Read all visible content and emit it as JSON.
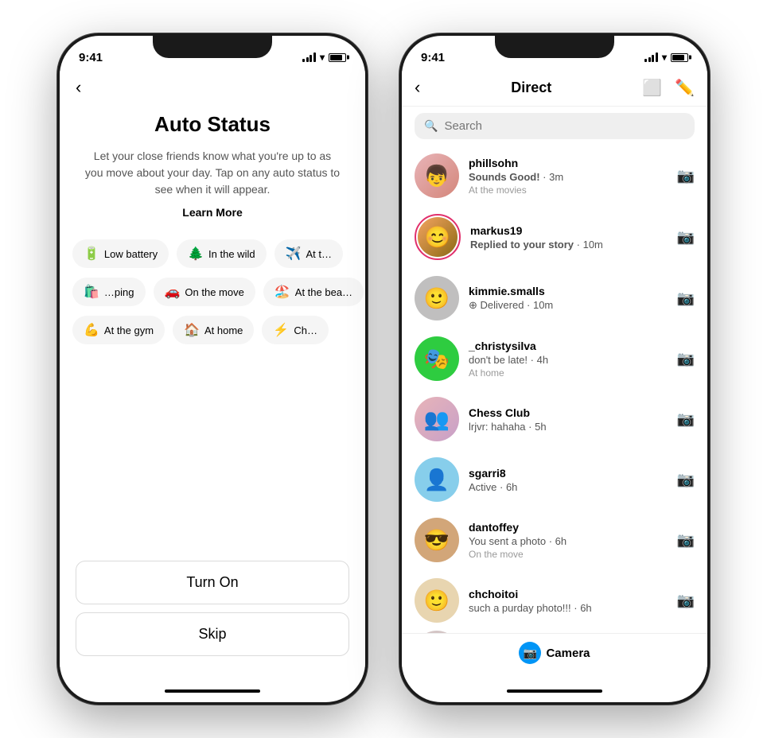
{
  "phone1": {
    "statusTime": "9:41",
    "title": "Auto Status",
    "description": "Let your close friends know what you're up to as you move about your day. Tap on any auto status to see when it will appear.",
    "learnMore": "Learn More",
    "rows": [
      [
        {
          "emoji": "🔋",
          "label": "Low battery"
        },
        {
          "emoji": "🌲",
          "label": "In the wild"
        },
        {
          "emoji": "✈️",
          "label": "At t…"
        }
      ],
      [
        {
          "emoji": "🛍️",
          "label": "…ping"
        },
        {
          "emoji": "🚗",
          "label": "On the move"
        },
        {
          "emoji": "🏖️",
          "label": "At the beac…"
        }
      ],
      [
        {
          "emoji": "💪",
          "label": "At the gym"
        },
        {
          "emoji": "🏠",
          "label": "At home"
        },
        {
          "emoji": "⚡",
          "label": "Ch…"
        }
      ]
    ],
    "turnOnLabel": "Turn On",
    "skipLabel": "Skip"
  },
  "phone2": {
    "statusTime": "9:41",
    "headerTitle": "Direct",
    "searchPlaceholder": "Search",
    "messages": [
      {
        "username": "phillsohn",
        "preview": "Sounds Good! · 3m",
        "status": "At the movies",
        "hasStoryRing": false,
        "avatarColor": "av-red",
        "avatarEmoji": "👤"
      },
      {
        "username": "markus19",
        "preview": "Replied to your story · 10m",
        "status": "",
        "hasStoryRing": true,
        "avatarColor": "av-orange",
        "avatarEmoji": "😊"
      },
      {
        "username": "kimmie.smalls",
        "preview": "⊕ Delivered · 10m",
        "status": "",
        "hasStoryRing": false,
        "avatarColor": "av-gray",
        "avatarEmoji": "🙂"
      },
      {
        "username": "_christysilva",
        "preview": "don't be late! · 4h",
        "status": "At home",
        "hasStoryRing": false,
        "avatarColor": "av-green",
        "avatarEmoji": "🎭"
      },
      {
        "username": "Chess Club",
        "preview": "lrjvr: hahaha · 5h",
        "status": "",
        "hasStoryRing": false,
        "avatarColor": "av-multi",
        "avatarEmoji": "👥"
      },
      {
        "username": "sgarri8",
        "preview": "Active · 6h",
        "status": "",
        "hasStoryRing": false,
        "avatarColor": "av-blue",
        "avatarEmoji": "👤"
      },
      {
        "username": "dantoffey",
        "preview": "You sent a photo · 6h",
        "status": "On the move",
        "hasStoryRing": false,
        "avatarColor": "av-brown",
        "avatarEmoji": "😎"
      },
      {
        "username": "chchoitoi",
        "preview": "such a purday photo!!! · 6h",
        "status": "",
        "hasStoryRing": false,
        "avatarColor": "av-blonde",
        "avatarEmoji": "🙂"
      }
    ],
    "cameraLabel": "Camera"
  }
}
